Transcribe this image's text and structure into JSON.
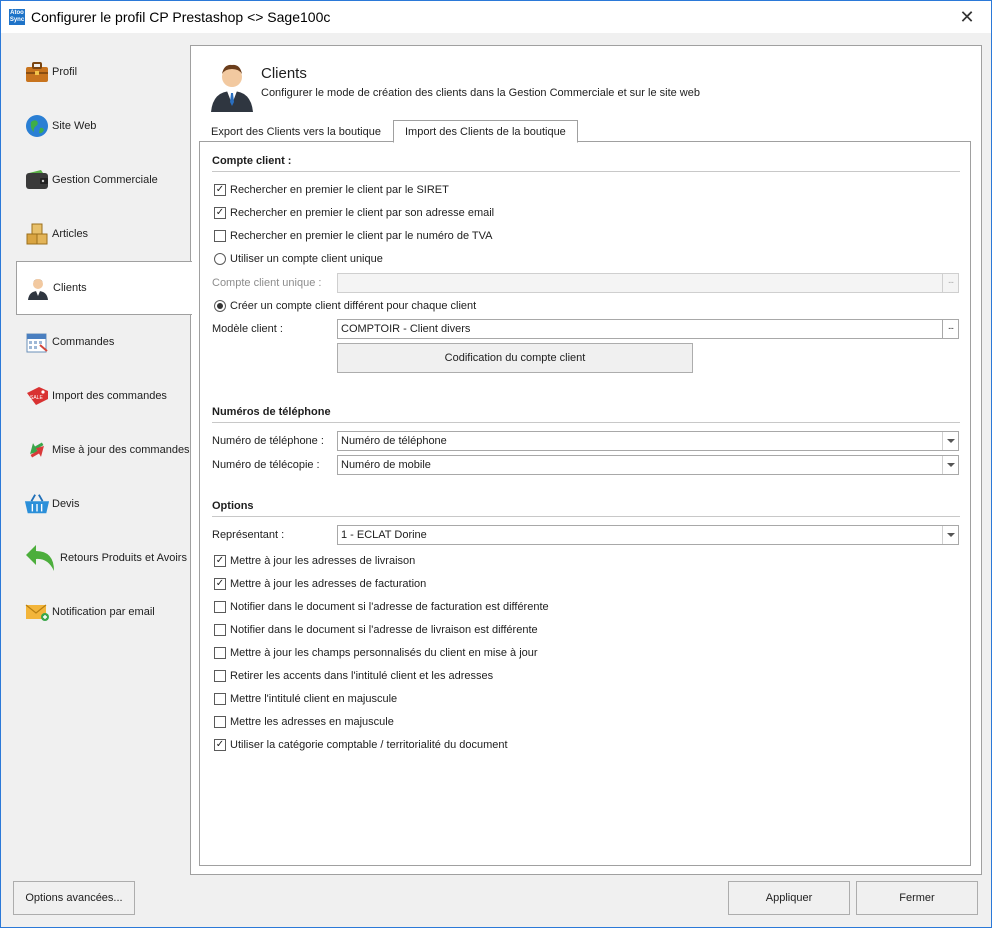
{
  "window": {
    "title": "Configurer le profil CP Prestashop <> Sage100c",
    "app_icon_text": "Atoo Sync"
  },
  "sidebar": {
    "items": [
      {
        "label": "Profil",
        "icon": "briefcase-icon"
      },
      {
        "label": "Site Web",
        "icon": "globe-icon"
      },
      {
        "label": "Gestion Commerciale",
        "icon": "wallet-icon"
      },
      {
        "label": "Articles",
        "icon": "boxes-icon"
      },
      {
        "label": "Clients",
        "icon": "user-icon",
        "active": true
      },
      {
        "label": "Commandes",
        "icon": "calendar-icon"
      },
      {
        "label": "Import des commandes",
        "icon": "sale-tag-icon"
      },
      {
        "label": "Mise à jour des commandes",
        "icon": "sync-arrows-icon"
      },
      {
        "label": "Devis",
        "icon": "basket-icon"
      },
      {
        "label": "Retours Produits et Avoirs",
        "icon": "return-arrow-icon"
      },
      {
        "label": "Notification par email",
        "icon": "envelope-icon"
      }
    ]
  },
  "header": {
    "title": "Clients",
    "subtitle": "Configurer le mode de création des clients dans la Gestion Commerciale et sur le site web"
  },
  "tabs": [
    {
      "label": "Export des Clients vers la boutique",
      "active": false
    },
    {
      "label": "Import des Clients de la boutique",
      "active": true
    }
  ],
  "compte_client": {
    "title": "Compte client :",
    "search_siret": {
      "label": "Rechercher en premier le client par le SIRET",
      "checked": true
    },
    "search_email": {
      "label": "Rechercher en premier le client par son adresse email",
      "checked": true
    },
    "search_tva": {
      "label": "Rechercher en premier le client par le numéro de TVA",
      "checked": false
    },
    "unique_radio": {
      "label": "Utiliser un compte client unique",
      "selected": false
    },
    "unique_field": {
      "label": "Compte client unique :",
      "value": "",
      "button": "..."
    },
    "different_radio": {
      "label": "Créer un compte client différent pour chaque client",
      "selected": true
    },
    "modele_field": {
      "label": "Modèle client :",
      "value": "COMPTOIR - Client divers",
      "button": "..."
    },
    "codification_button": "Codification du compte client"
  },
  "telephone": {
    "title": "Numéros de téléphone",
    "phone": {
      "label": "Numéro de téléphone :",
      "value": "Numéro de téléphone"
    },
    "fax": {
      "label": "Numéro de télécopie :",
      "value": "Numéro de mobile"
    }
  },
  "options": {
    "title": "Options",
    "representant": {
      "label": "Représentant :",
      "value": "1 - ECLAT Dorine"
    },
    "checks": [
      {
        "label": "Mettre à jour les adresses de livraison",
        "checked": true
      },
      {
        "label": "Mettre à jour les adresses de facturation",
        "checked": true
      },
      {
        "label": "Notifier dans le document si l'adresse de facturation est différente",
        "checked": false
      },
      {
        "label": "Notifier dans le document si l'adresse de livraison est différente",
        "checked": false
      },
      {
        "label": "Mettre à jour les champs personnalisés du client en mise à jour",
        "checked": false
      },
      {
        "label": "Retirer les accents dans l'intitulé client et les adresses",
        "checked": false
      },
      {
        "label": "Mettre l'intitulé client en majuscule",
        "checked": false
      },
      {
        "label": "Mettre les adresses en majuscule",
        "checked": false
      },
      {
        "label": "Utiliser la catégorie comptable / territorialité du document",
        "checked": true
      }
    ]
  },
  "footer": {
    "advanced_button": "Options avancées...",
    "apply_button": "Appliquer",
    "close_button": "Fermer"
  },
  "colors": {
    "accent": "#2b79d8",
    "panel_bg": "#f0f0f0",
    "border": "#a0a0a0"
  }
}
